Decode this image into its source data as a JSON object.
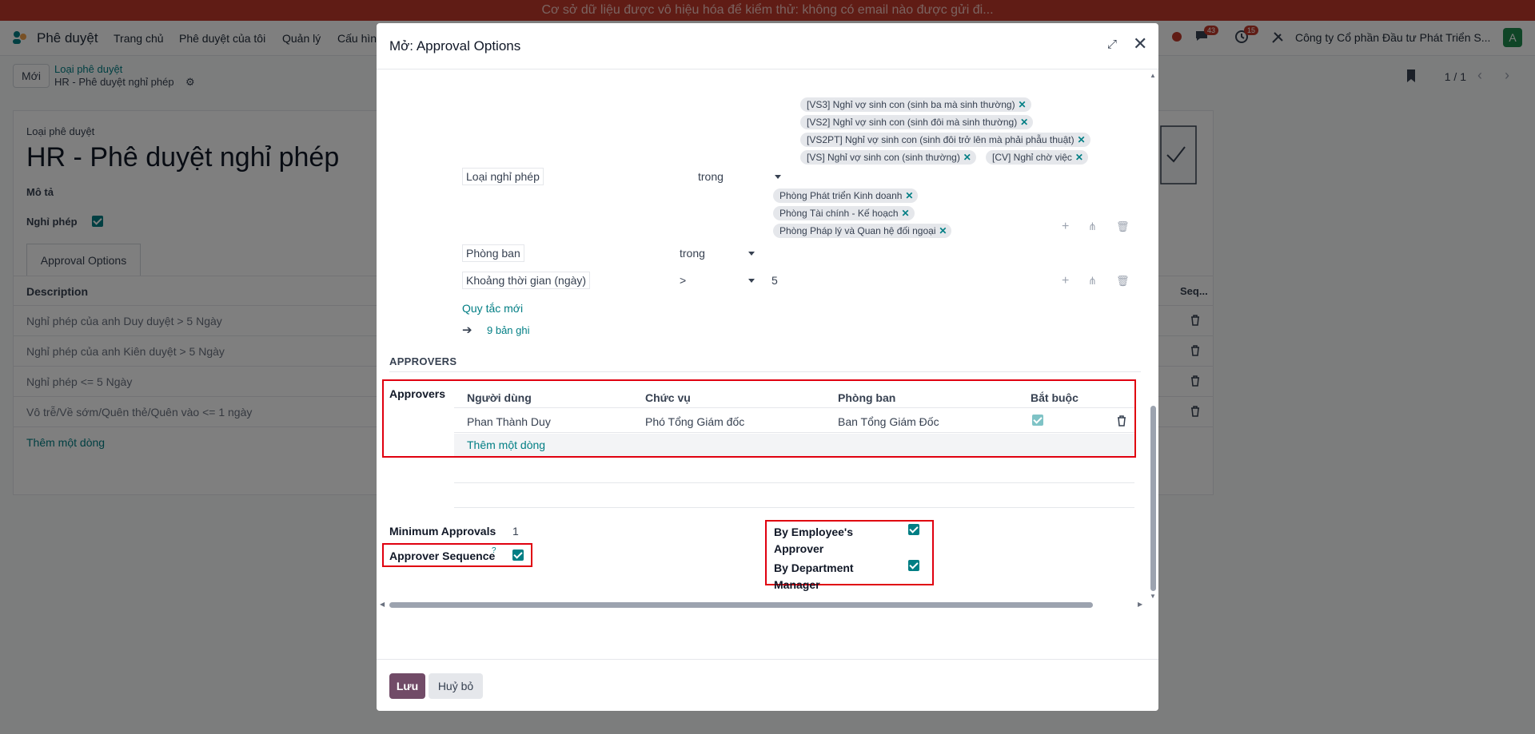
{
  "banner": {
    "text": "Cơ sở dữ liệu được vô hiệu hóa để kiểm thử: không có email nào được gửi đi..."
  },
  "navbar": {
    "app_name": "Phê duyệt",
    "menu": [
      "Trang chủ",
      "Phê duyệt của tôi",
      "Quản lý",
      "Cấu hìn"
    ],
    "messages_count": "43",
    "activities_count": "15",
    "company": "Công ty Cổ phần Đầu tư Phát Triển S...",
    "avatar_letter": "A"
  },
  "control_panel": {
    "new_button": "Mới",
    "breadcrumb_parent": "Loại phê duyệt",
    "breadcrumb_current": "HR - Phê duyệt nghỉ phép",
    "pager": "1 / 1"
  },
  "form": {
    "type_label": "Loại phê duyệt",
    "title": "HR - Phê duyệt nghỉ phép",
    "description_label": "Mô tả",
    "leave_label": "Nghỉ phép",
    "tab": "Approval Options",
    "table": {
      "col_description": "Description",
      "col_seq": "Seq...",
      "rows": [
        "Nghỉ phép của anh Duy duyệt > 5 Ngày",
        "Nghỉ phép của anh Kiên duyệt > 5 Ngày",
        "Nghỉ phép <= 5 Ngày",
        "Vô trễ/Về sớm/Quên thẻ/Quên vào <= 1 ngày"
      ],
      "add_line": "Thêm một dòng"
    }
  },
  "modal": {
    "title": "Mở: Approval Options",
    "domain": {
      "leave_tags": [
        "[VS3] Nghỉ vợ sinh con (sinh ba mà sinh thường)",
        "[VS2] Nghỉ vợ sinh con (sinh đôi mà sinh thường)",
        "[VS2PT] Nghỉ vợ sinh con (sinh đôi trở lên mà phải phẫu thuật)",
        "[VS] Nghỉ vợ sinh con (sinh thường)",
        "[CV] Nghỉ chờ việc"
      ],
      "rule1_field": "Loại nghỉ phép",
      "rule1_op": "trong",
      "dept_tags": [
        "Phòng Phát triển Kinh doanh",
        "Phòng Tài chính - Kế hoạch",
        "Phòng Pháp lý và Quan hệ đối ngoại"
      ],
      "rule2_field": "Phòng ban",
      "rule2_op": "trong",
      "rule3_field": "Khoảng thời gian (ngày)",
      "rule3_op": ">",
      "rule3_value": "5",
      "new_rule": "Quy tắc mới",
      "records": "9 bản ghi"
    },
    "approvers_section": "APPROVERS",
    "approvers_label": "Approvers",
    "approvers_table": {
      "col_user": "Người dùng",
      "col_position": "Chức vụ",
      "col_department": "Phòng ban",
      "col_required": "Bắt buộc",
      "row": {
        "user": "Phan Thành Duy",
        "position": "Phó Tổng Giám đốc",
        "department": "Ban Tổng Giám Đốc",
        "required": true
      },
      "add_line": "Thêm một dòng"
    },
    "min_approvals_label": "Minimum Approvals",
    "min_approvals_value": "1",
    "approver_sequence_label": "Approver Sequence",
    "approver_sequence_help": "?",
    "by_employee_approver_line1": "By Employee's",
    "by_employee_approver_line2": "Approver",
    "by_department_manager_line1": "By Department",
    "by_department_manager_line2": "Manager",
    "save_button": "Lưu",
    "cancel_button": "Huỷ bỏ"
  },
  "colors": {
    "banner": "#c0392b",
    "accent": "#017e84",
    "primary": "#714b67",
    "highlight": "#e0000f"
  }
}
